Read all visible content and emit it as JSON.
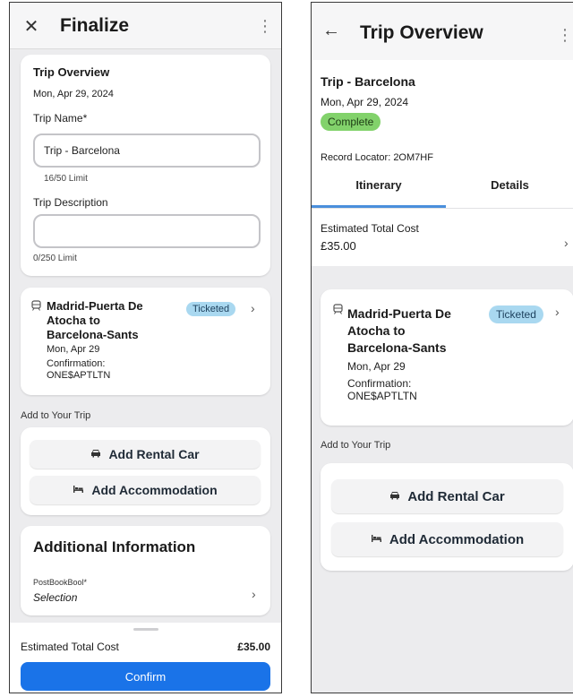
{
  "left": {
    "header": {
      "title": "Finalize",
      "close_icon": "close-icon",
      "menu_icon": "more-vertical-icon"
    },
    "trip_card": {
      "title": "Trip Overview",
      "date": "Mon, Apr 29, 2024",
      "trip_name_label": "Trip Name*",
      "trip_name_value": "Trip - Barcelona",
      "trip_name_limit": "16/50 Limit",
      "trip_description_label": "Trip Description",
      "trip_description_value": "",
      "trip_description_limit": "0/250 Limit"
    },
    "segment": {
      "icon": "train-icon",
      "title_lines": [
        "Madrid-Puerta De",
        "Atocha to",
        "Barcelona-Sants"
      ],
      "date": "Mon, Apr 29",
      "confirmation_label": "Confirmation:",
      "confirmation_code": "ONE$APTLTN",
      "status": "Ticketed"
    },
    "add_to_trip": {
      "label": "Add to Your Trip",
      "rental_car": {
        "label": "Add Rental Car",
        "icon": "car-icon"
      },
      "accommodation": {
        "label": "Add Accommodation",
        "icon": "bed-icon"
      }
    },
    "additional": {
      "title": "Additional Information",
      "field_label": "PostBookBool*",
      "field_value": "Selection"
    },
    "footer": {
      "cost_label": "Estimated Total Cost",
      "cost_value": "£35.00",
      "confirm_label": "Confirm"
    }
  },
  "right": {
    "header": {
      "title": "Trip Overview",
      "back_icon": "arrow-left-icon",
      "menu_icon": "more-vertical-icon"
    },
    "trip": {
      "name": "Trip - Barcelona",
      "date": "Mon, Apr 29, 2024",
      "status": "Complete",
      "record_locator": "Record Locator: 2OM7HF"
    },
    "tabs": [
      {
        "label": "Itinerary",
        "active": true
      },
      {
        "label": "Details",
        "active": false
      }
    ],
    "cost": {
      "label": "Estimated Total Cost",
      "value": "£35.00"
    },
    "segment": {
      "icon": "train-icon",
      "title_lines": [
        "Madrid-Puerta De",
        "Atocha to",
        "Barcelona-Sants"
      ],
      "date": "Mon, Apr 29",
      "confirmation_label": "Confirmation:",
      "confirmation_code": "ONE$APTLTN",
      "status": "Ticketed"
    },
    "add_to_trip": {
      "label": "Add to Your Trip",
      "rental_car": {
        "label": "Add Rental Car",
        "icon": "car-icon"
      },
      "accommodation": {
        "label": "Add Accommodation",
        "icon": "bed-icon"
      }
    }
  },
  "colors": {
    "primary": "#1a73e8",
    "ticketed_badge": "#a9d8f0",
    "complete_badge": "#82d26b",
    "tab_active": "#4a8fdc"
  }
}
